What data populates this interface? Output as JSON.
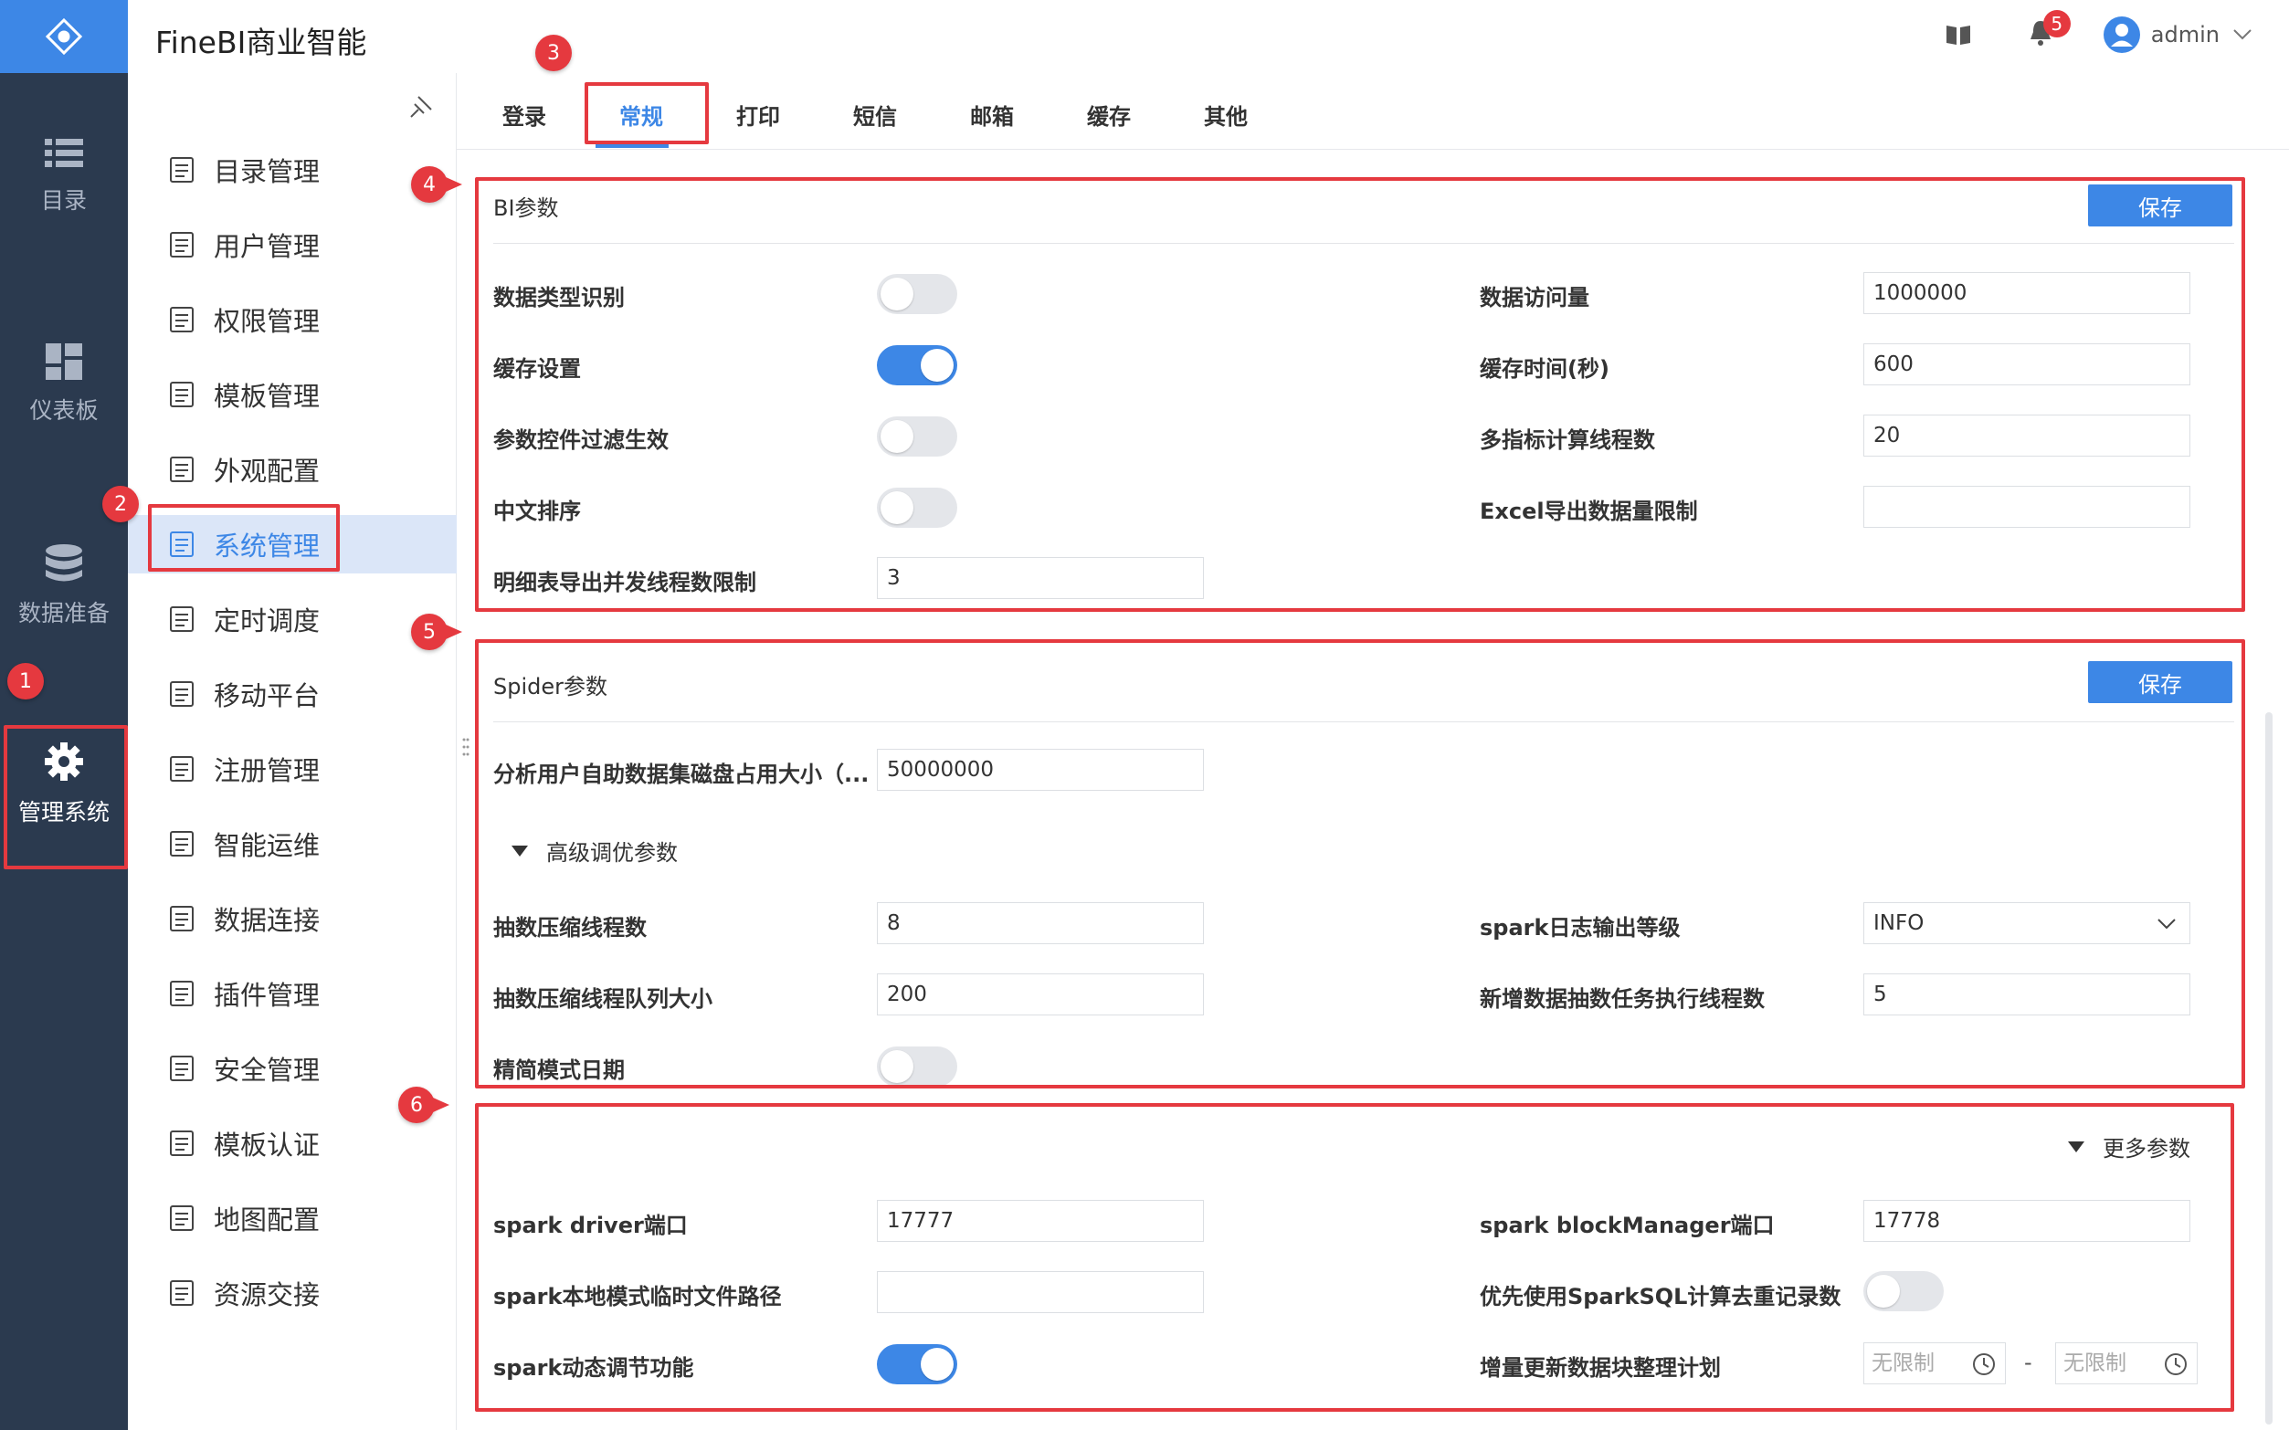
{
  "header": {
    "title": "FineBI商业智能",
    "notif_count": "5",
    "user": "admin"
  },
  "leftnav": [
    {
      "label": "目录",
      "icon": "list-icon"
    },
    {
      "label": "仪表板",
      "icon": "dashboard-icon"
    },
    {
      "label": "数据准备",
      "icon": "database-icon"
    },
    {
      "label": "管理系统",
      "icon": "gear-icon"
    }
  ],
  "subnav": [
    {
      "label": "目录管理"
    },
    {
      "label": "用户管理"
    },
    {
      "label": "权限管理"
    },
    {
      "label": "模板管理"
    },
    {
      "label": "外观配置"
    },
    {
      "label": "系统管理"
    },
    {
      "label": "定时调度"
    },
    {
      "label": "移动平台"
    },
    {
      "label": "注册管理"
    },
    {
      "label": "智能运维"
    },
    {
      "label": "数据连接"
    },
    {
      "label": "插件管理"
    },
    {
      "label": "安全管理"
    },
    {
      "label": "模板认证"
    },
    {
      "label": "地图配置"
    },
    {
      "label": "资源交接"
    }
  ],
  "tabs": [
    "登录",
    "常规",
    "打印",
    "短信",
    "邮箱",
    "缓存",
    "其他"
  ],
  "bi": {
    "title": "BI参数",
    "save": "保存",
    "type_detect": "数据类型识别",
    "cache_setting": "缓存设置",
    "param_filter": "参数控件过滤生效",
    "cn_sort": "中文排序",
    "detail_export_threads": "明细表导出并发线程数限制",
    "detail_export_threads_val": "3",
    "access_volume": "数据访问量",
    "access_volume_val": "1000000",
    "cache_time": "缓存时间(秒)",
    "cache_time_val": "600",
    "multi_threads": "多指标计算线程数",
    "multi_threads_val": "20",
    "excel_limit": "Excel导出数据量限制",
    "excel_limit_val": ""
  },
  "spider": {
    "title": "Spider参数",
    "save": "保存",
    "disk_usage": "分析用户自助数据集磁盘占用大小（...",
    "disk_usage_val": "50000000",
    "advanced": "高级调优参数",
    "compress_threads": "抽数压缩线程数",
    "compress_threads_val": "8",
    "compress_queue": "抽数压缩线程队列大小",
    "compress_queue_val": "200",
    "simple_date": "精简模式日期",
    "spark_log": "spark日志输出等级",
    "spark_log_val": "INFO",
    "new_extract_threads": "新增数据抽数任务执行线程数",
    "new_extract_threads_val": "5"
  },
  "more": {
    "toggle": "更多参数",
    "driver_port": "spark driver端口",
    "driver_port_val": "17777",
    "local_tmp": "spark本地模式临时文件路径",
    "local_tmp_val": "",
    "dynamic": "spark动态调节功能",
    "bm_port": "spark blockManager端口",
    "bm_port_val": "17778",
    "sparksql_dedup": "优先使用SparkSQL计算去重记录数",
    "incr_plan": "增量更新数据块整理计划",
    "incr_from": "无限制",
    "incr_sep": "-",
    "incr_to": "无限制"
  },
  "badges": [
    "1",
    "2",
    "3",
    "4",
    "5",
    "6"
  ],
  "colors": {
    "accent": "#3d87e6",
    "highlight": "#e5393f",
    "nav_bg": "#2b3a4f"
  }
}
